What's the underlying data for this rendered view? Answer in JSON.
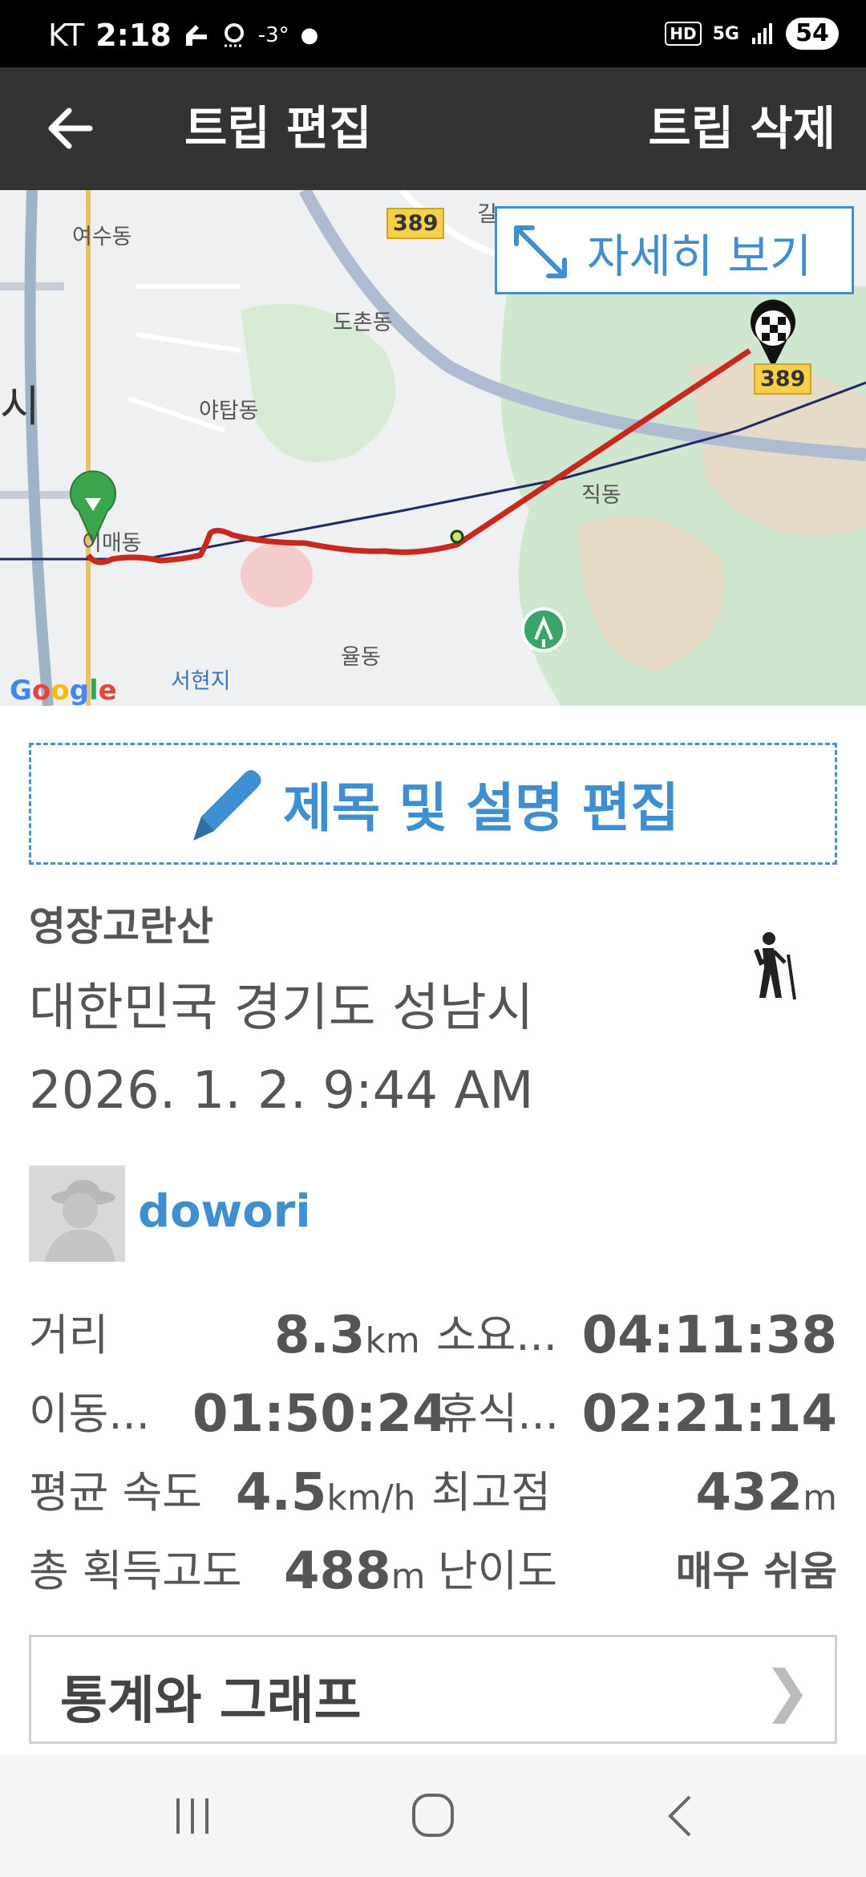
{
  "status_bar": {
    "carrier": "KT",
    "time": "2:18",
    "temperature": "-3°",
    "hd_badge": "HD",
    "network_badge": "5G",
    "battery": "54"
  },
  "app_bar": {
    "title": "트립 편집",
    "delete_label": "트립 삭제",
    "back_icon": "arrow-left-icon"
  },
  "map": {
    "expand_label": "자세히 보기",
    "labels": {
      "yeosu": "여수동",
      "dochon": "도촌동",
      "yatap": "야탑동",
      "imae": "이매동",
      "jik": "직동",
      "yul": "율동",
      "seohyeon": "서현지",
      "si": "시"
    },
    "road_number": "389",
    "road_number_2": "389",
    "top_partial": "길"
  },
  "edit_button": {
    "label": "제목 및 설명 편집",
    "icon": "pencil-icon"
  },
  "trip": {
    "name": "영장고란산",
    "location": "대한민국 경기도 성남시",
    "date": "2026. 1. 2. 9:44 AM",
    "activity_icon": "hiker-icon"
  },
  "user": {
    "name": "dowori"
  },
  "stats": {
    "distance_label": "거리",
    "distance_value": "8.3",
    "distance_unit": "km",
    "duration_label": "소요...",
    "duration_value": "04:11:38",
    "moving_label": "이동...",
    "moving_value": "01:50:24",
    "rest_label": "휴식...",
    "rest_value": "02:21:14",
    "avg_speed_label": "평균 속도",
    "avg_speed_value": "4.5",
    "avg_speed_unit": "km/h",
    "max_alt_label": "최고점",
    "max_alt_value": "432",
    "max_alt_unit": "m",
    "gain_label": "총 획득고도",
    "gain_value": "488",
    "gain_unit": "m",
    "difficulty_label": "난이도",
    "difficulty_value": "매우 쉬움"
  },
  "graph_button": {
    "label": "통계와 그래프",
    "chevron": "❯"
  }
}
